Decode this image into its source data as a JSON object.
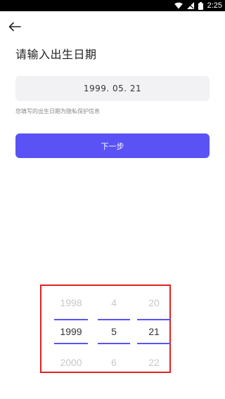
{
  "status_bar": {
    "time": "2:25"
  },
  "header": {
    "back_icon": "arrow-left-icon"
  },
  "title": "请输入出生日期",
  "date_field": {
    "value": "1999. 05. 21"
  },
  "privacy_note": "您填写的出生日期为隐私保护信息",
  "next_button": {
    "label": "下一步"
  },
  "picker": {
    "year": {
      "prev": "1998",
      "selected": "1999",
      "next": "2000"
    },
    "month": {
      "prev": "4",
      "selected": "5",
      "next": "6"
    },
    "day": {
      "prev": "20",
      "selected": "21",
      "next": "22"
    }
  },
  "colors": {
    "accent": "#5b52f5",
    "highlight_frame": "#e02020"
  }
}
